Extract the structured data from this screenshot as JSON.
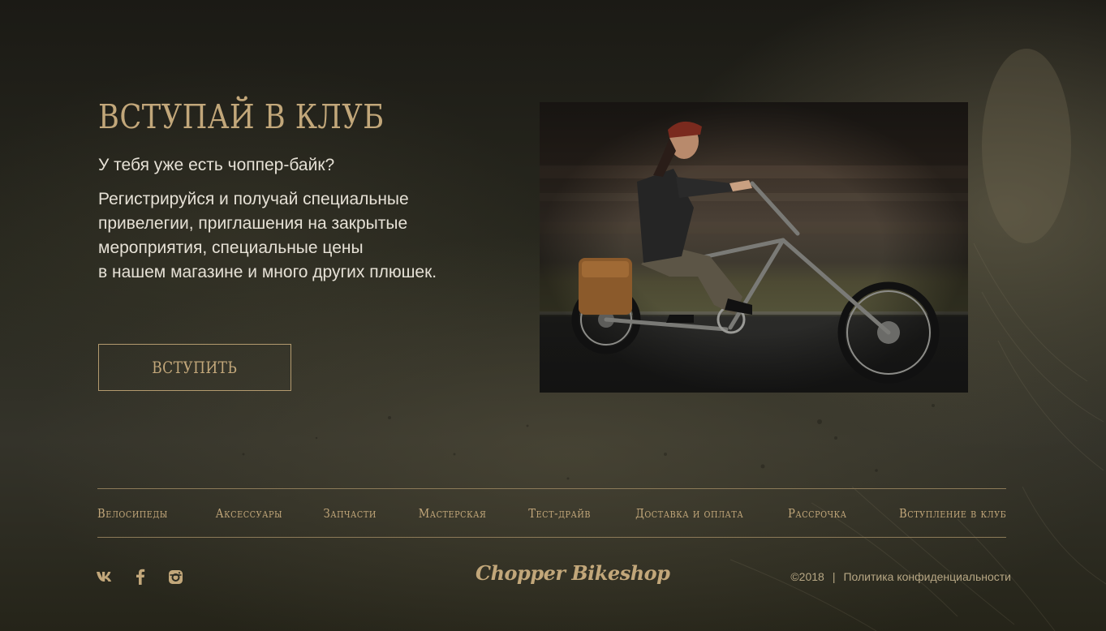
{
  "hero": {
    "title": "ВСТУПАЙ В КЛУБ",
    "question": "У тебя уже есть чоппер-байк?",
    "text_lines": [
      "Регистрируйся и получай специальные",
      "привелегии, приглашения на закрытые",
      "мероприятия, специальные цены",
      "в нашем магазине и много других плюшек."
    ],
    "button_label": "ВСТУПИТЬ",
    "photo": "man-riding-chopper-bicycle"
  },
  "footer": {
    "nav": [
      "Велосипеды",
      "Аксессуары",
      "Запчасти",
      "Мастерская",
      "Тест-драйв",
      "Доставка и оплата",
      "Рассрочка",
      "Вступление в клуб"
    ],
    "social": [
      "vk-icon",
      "facebook-icon",
      "instagram-icon"
    ],
    "logo": "Chopper Bikeshop",
    "copyright": "©2018",
    "separator": "|",
    "privacy_link": "Политика конфиденциальности"
  },
  "colors": {
    "accent_gold": "#c2a77a",
    "text_light": "#e6e1d6",
    "divider": "#8c7a58",
    "background_dark": "#1b1a15"
  }
}
